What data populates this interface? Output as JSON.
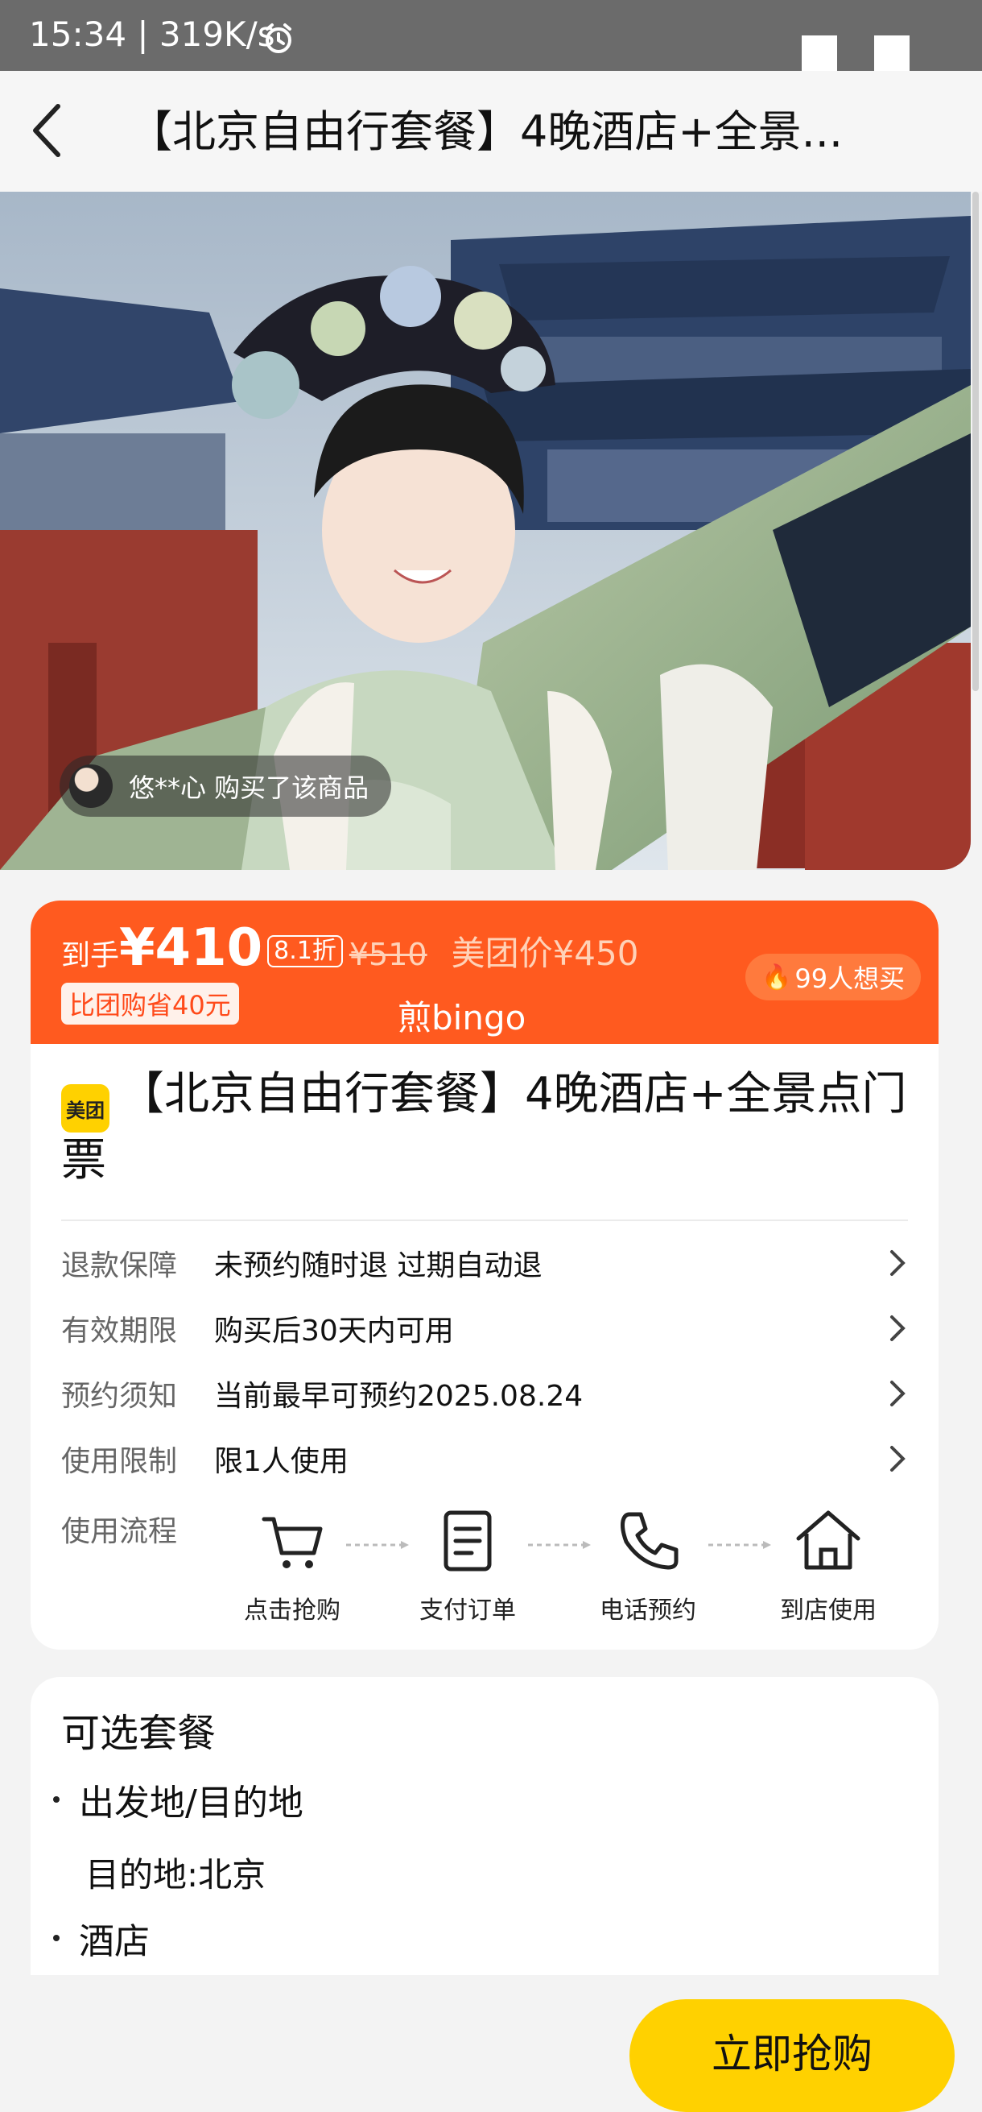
{
  "status_bar": {
    "text": "15:34 | 319K/s",
    "icons": [
      "alarm-icon"
    ]
  },
  "header": {
    "title": "【北京自由行套餐】4晚酒店+全景...",
    "icons": [
      "back-icon"
    ]
  },
  "hero": {
    "buyer_toast": "悠**心 购买了该商品"
  },
  "price": {
    "prefix": "到手",
    "value": "¥410",
    "discount": "8.1折",
    "original": "¥510",
    "meituan_price": "美团价¥450",
    "save_badge": "比团购省40元",
    "seller": "煎bingo",
    "want_count": "99人想买",
    "colors": {
      "banner": "#ff5a1f",
      "save_text": "#ff4a1a"
    }
  },
  "product": {
    "logo_text": "美团",
    "title": "【北京自由行套餐】4晚酒店+全景点门票"
  },
  "info_rows": [
    {
      "label": "退款保障",
      "value": "未预约随时退 过期自动退"
    },
    {
      "label": "有效期限",
      "value": "购买后30天内可用"
    },
    {
      "label": "预约须知",
      "value": "当前最早可预约2025.08.24"
    },
    {
      "label": "使用限制",
      "value": "限1人使用"
    }
  ],
  "flow": {
    "label": "使用流程",
    "steps": [
      {
        "icon": "cart-icon",
        "label": "点击抢购"
      },
      {
        "icon": "order-icon",
        "label": "支付订单"
      },
      {
        "icon": "phone-icon",
        "label": "电话预约"
      },
      {
        "icon": "store-icon",
        "label": "到店使用"
      }
    ]
  },
  "packages": {
    "heading": "可选套餐",
    "items": [
      {
        "title": "出发地/目的地",
        "detail": "目的地:北京"
      },
      {
        "title": "酒店"
      }
    ]
  },
  "actions": {
    "buy_label": "立即抢购",
    "accent": "#ffd100"
  }
}
